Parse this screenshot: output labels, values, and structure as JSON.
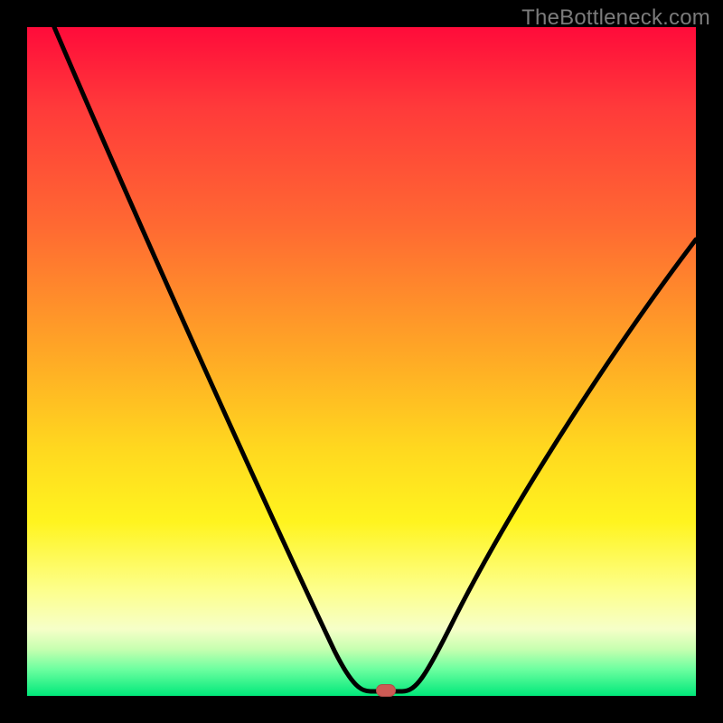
{
  "watermark": "TheBottleneck.com",
  "colors": {
    "frame": "#000000",
    "gradient_top": "#ff0b3a",
    "gradient_bottom": "#00e87a",
    "curve": "#000000",
    "marker": "#cc5a54",
    "watermark": "#7b7b7b"
  },
  "chart_data": {
    "type": "line",
    "title": "",
    "xlabel": "",
    "ylabel": "",
    "xlim": [
      0,
      100
    ],
    "ylim": [
      0,
      100
    ],
    "grid": false,
    "legend": false,
    "annotations": [],
    "series": [
      {
        "name": "bottleneck-curve",
        "x": [
          4,
          8,
          12,
          16,
          20,
          24,
          28,
          32,
          36,
          40,
          44,
          47,
          49,
          51,
          54,
          56,
          60,
          64,
          68,
          72,
          76,
          80,
          84,
          88,
          92,
          96,
          100
        ],
        "y": [
          100,
          92,
          84,
          76,
          68,
          60,
          52,
          44,
          36,
          28,
          20,
          12,
          5,
          1,
          1,
          1,
          8,
          16,
          24,
          31,
          38,
          44,
          50,
          55,
          60,
          64,
          68
        ]
      }
    ],
    "marker": {
      "x": 53,
      "y": 1
    }
  }
}
